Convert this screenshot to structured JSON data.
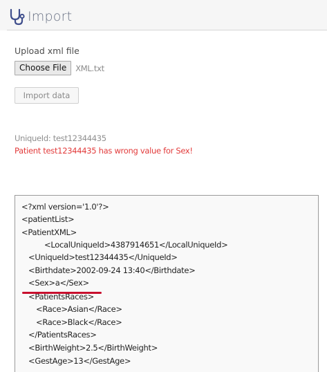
{
  "header": {
    "title": "Import",
    "icon": "stethoscope-icon",
    "icon_color": "#3f4e8c"
  },
  "upload": {
    "label": "Upload xml file",
    "choose_button": "Choose File",
    "file_name": "XML.txt"
  },
  "import_button": "Import data",
  "messages": {
    "unique_id": "UniqueId: test12344435",
    "error": "Patient test12344435 has wrong value for Sex!",
    "error_color": "#e23b3b"
  },
  "xml_lines": [
    "<?xml version='1.0'?>",
    "<patientList>",
    "<PatientXML>",
    "<LocalUniqueId>4387914651</LocalUniqueId>",
    "<UniqueId>test12344435</UniqueId>",
    "<Birthdate>2002-09-24 13:40</Birthdate>",
    "<Sex>a</Sex>",
    "<PatientsRaces>",
    "<Race>Asian</Race>",
    "<Race>Black</Race>",
    "</PatientsRaces>",
    "<BirthWeight>2.5</BirthWeight>",
    "<GestAge>13</GestAge>"
  ],
  "annotation": {
    "color": "#c8102e"
  }
}
